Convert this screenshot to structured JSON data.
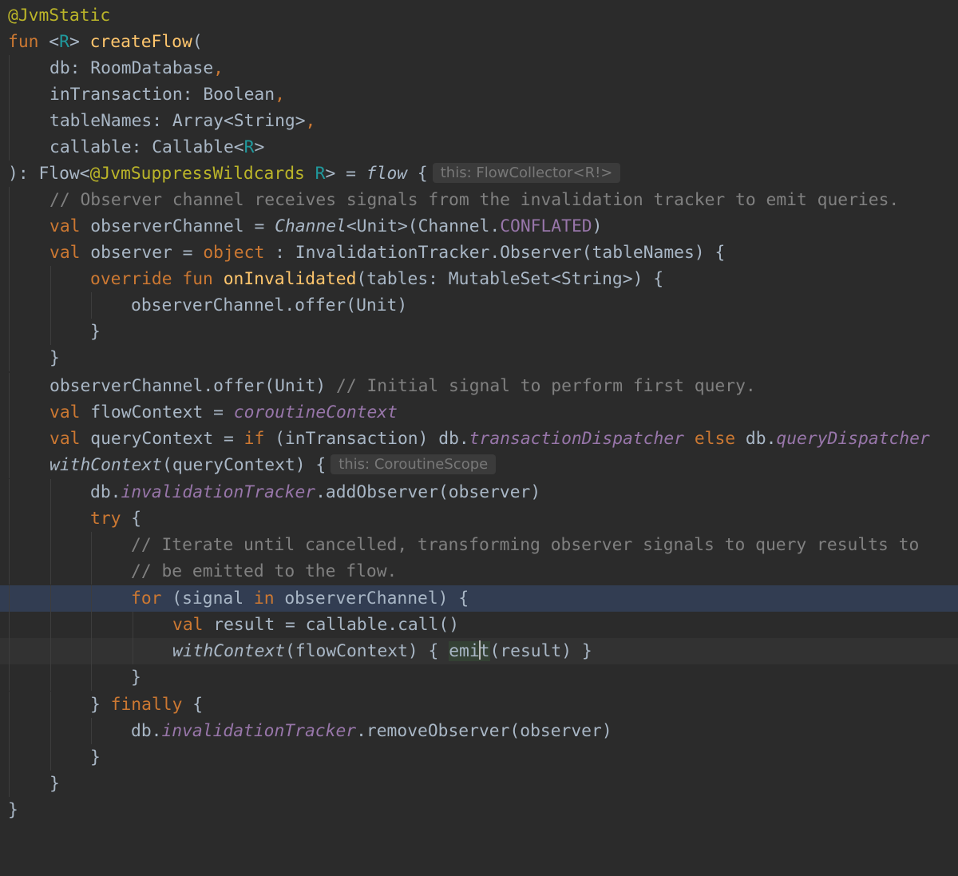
{
  "code": {
    "lines": [
      [
        "@JvmStatic"
      ],
      [
        "fun",
        " <",
        "R",
        "> ",
        "createFlow",
        "("
      ],
      [
        "db: RoomDatabase",
        ","
      ],
      [
        "inTransaction: Boolean",
        ","
      ],
      [
        "tableNames: Array<String>",
        ","
      ],
      [
        "callable: Callable<",
        "R",
        ">"
      ],
      [
        "): Flow<",
        "@JvmSuppressWildcards",
        " ",
        "R",
        "> = ",
        "flow",
        " {"
      ],
      [
        "// Observer channel receives signals from the invalidation tracker to emit queries."
      ],
      [
        "val",
        " observerChannel = ",
        "Channel",
        "<Unit>(Channel.",
        "CONFLATED",
        ")"
      ],
      [
        "val",
        " observer = ",
        "object",
        " : InvalidationTracker.Observer(tableNames) {"
      ],
      [
        "override",
        " ",
        "fun",
        " ",
        "onInvalidated",
        "(tables: MutableSet<String>) {"
      ],
      [
        "observerChannel.offer(Unit)"
      ],
      [
        "}"
      ],
      [
        "}"
      ],
      [
        "observerChannel.offer(Unit) ",
        "// Initial signal to perform first query."
      ],
      [
        "val",
        " flowContext = ",
        "coroutineContext"
      ],
      [
        "val",
        " queryContext = ",
        "if",
        " (inTransaction) db.",
        "transactionDispatcher",
        " ",
        "else",
        " db.",
        "queryDispatcher"
      ],
      [
        "withContext",
        "(queryContext) {"
      ],
      [
        "db.",
        "invalidationTracker",
        ".addObserver(observer)"
      ],
      [
        "try",
        " {"
      ],
      [
        "// Iterate until cancelled, transforming observer signals to query results to"
      ],
      [
        "// be emitted to the flow."
      ],
      [
        "for",
        " (signal ",
        "in",
        " observerChannel) {"
      ],
      [
        "val",
        " result = callable.call()"
      ],
      [
        "withContext",
        "(flowContext) { ",
        "emi",
        "t",
        "(result) }"
      ],
      [
        "}"
      ],
      [
        "} ",
        "finally",
        " {"
      ],
      [
        "db.",
        "invalidationTracker",
        ".removeObserver(observer)"
      ],
      [
        "}"
      ],
      [
        "}"
      ],
      [
        "}"
      ]
    ]
  },
  "hints": {
    "flow_receiver": "this: FlowCollector<R!>",
    "coroutine_scope": "this: CoroutineScope"
  },
  "colors": {
    "background": "#2b2b2b",
    "default_text": "#a9b7c6",
    "keyword": "#cc7832",
    "annotation": "#bbb529",
    "function_decl": "#ffc66d",
    "type_param": "#20999d",
    "comment": "#808080",
    "property": "#9876aa",
    "selected_line": "#323d52",
    "caret_line": "#323232"
  }
}
